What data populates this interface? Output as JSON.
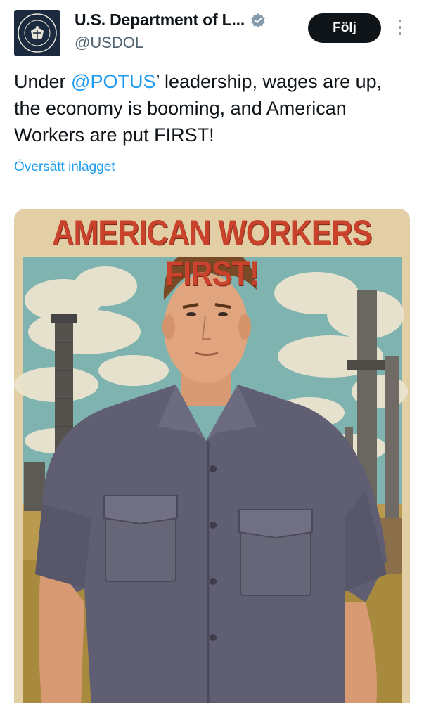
{
  "account": {
    "display_name": "U.S. Department of L...",
    "handle": "@USDOL",
    "verified": true,
    "avatar_icon": "department-of-labor-seal-icon",
    "seal_text": "DEPARTMENT OF LABOR · UNITED STATES OF AMERICA"
  },
  "actions": {
    "follow_label": "Följ",
    "more_icon": "more-vertical-icon"
  },
  "tweet": {
    "text_before": "Under ",
    "mention": "@POTUS",
    "text_after": "’ leadership, wages are up, the economy is booming, and American Workers are put FIRST!",
    "translate_label": "Översätt inlägget"
  },
  "media": {
    "poster_title": "AMERICAN WORKERS FIRST!"
  },
  "colors": {
    "link": "#1d9bf0",
    "follow_bg": "#0f1419",
    "text": "#0f1419",
    "secondary": "#536471",
    "poster_title": "#c9432c"
  }
}
